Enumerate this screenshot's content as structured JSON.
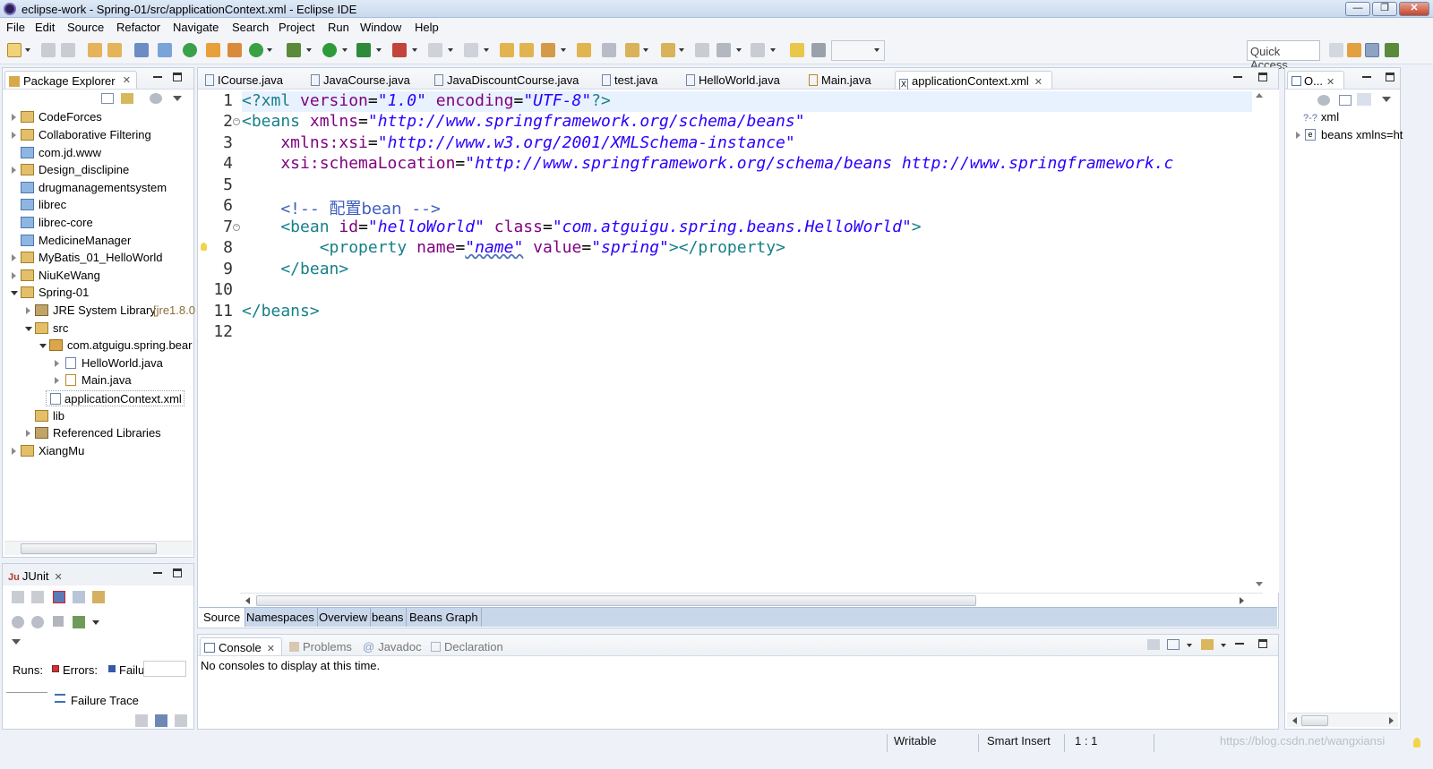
{
  "window": {
    "title": "eclipse-work - Spring-01/src/applicationContext.xml - Eclipse IDE",
    "controls": {
      "minimize": "—",
      "restore": "❐",
      "close": "✕"
    }
  },
  "menu": [
    "File",
    "Edit",
    "Source",
    "Refactor",
    "Navigate",
    "Search",
    "Project",
    "Run",
    "Window",
    "Help"
  ],
  "toolbar": {
    "quick_access": "Quick Access"
  },
  "package_explorer": {
    "title": "Package Explorer",
    "items": [
      {
        "label": "CodeForces",
        "suffix": ""
      },
      {
        "label": "Collaborative Filtering",
        "suffix": ""
      },
      {
        "label": "com.jd.www",
        "suffix": ""
      },
      {
        "label": "Design_disclipine",
        "suffix": ""
      },
      {
        "label": "drugmanagementsystem",
        "suffix": ""
      },
      {
        "label": "librec",
        "suffix": ""
      },
      {
        "label": "librec-core",
        "suffix": ""
      },
      {
        "label": "MedicineManager",
        "suffix": ""
      },
      {
        "label": "MyBatis_01_HelloWorld",
        "suffix": ""
      },
      {
        "label": "NiuKeWang",
        "suffix": ""
      },
      {
        "label": "Spring-01",
        "suffix": ""
      },
      {
        "label": "JRE System Library",
        "suffix": "[jre1.8.0"
      },
      {
        "label": "src",
        "suffix": ""
      },
      {
        "label": "com.atguigu.spring.bear",
        "suffix": ""
      },
      {
        "label": "HelloWorld.java",
        "suffix": ""
      },
      {
        "label": "Main.java",
        "suffix": ""
      },
      {
        "label": "applicationContext.xml",
        "suffix": ""
      },
      {
        "label": "lib",
        "suffix": ""
      },
      {
        "label": "Referenced Libraries",
        "suffix": ""
      },
      {
        "label": "XiangMu",
        "suffix": ""
      }
    ]
  },
  "junit": {
    "title": "JUnit",
    "runs_label": "Runs:",
    "errors_label": "Errors:",
    "failures_label": "Failu",
    "failure_trace": "Failure Trace"
  },
  "editor": {
    "tabs": [
      "ICourse.java",
      "JavaCourse.java",
      "JavaDiscountCourse.java",
      "test.java",
      "HelloWorld.java",
      "Main.java",
      "applicationContext.xml"
    ],
    "active_tab": "applicationContext.xml",
    "line_numbers": [
      "1",
      "2",
      "3",
      "4",
      "5",
      "6",
      "7",
      "8",
      "9",
      "10",
      "11",
      "12"
    ],
    "code": {
      "l1": {
        "a": "<?xml ",
        "b": "version",
        "c": "=",
        "d": "\"1.0\"",
        "e": " encoding",
        "f": "=",
        "g": "\"UTF-8\"",
        "h": "?>"
      },
      "l2": {
        "a": "<beans ",
        "b": "xmlns",
        "c": "=",
        "d": "\"http://www.springframework.org/schema/beans\""
      },
      "l3": {
        "a": "    xmlns:xsi",
        "b": "=",
        "c": "\"http://www.w3.org/2001/XMLSchema-instance\""
      },
      "l4": {
        "a": "    xsi:schemaLocation",
        "b": "=",
        "c": "\"http://www.springframework.org/schema/beans http://www.springframework.c"
      },
      "l6": {
        "a": "    <!-- ",
        "b": "配置bean",
        "c": " -->"
      },
      "l7": {
        "a": "    <bean ",
        "b": "id",
        "c": "=",
        "d": "\"helloWorld\"",
        "e": " class",
        "f": "=",
        "g": "\"com.atguigu.spring.beans.HelloWorld\"",
        "h": ">"
      },
      "l8": {
        "a": "        <property ",
        "b": "name",
        "c": "=",
        "d": "\"name\"",
        "e": " value",
        "f": "=",
        "g": "\"spring\"",
        "h": "></property>"
      },
      "l9": {
        "a": "    </bean>"
      },
      "l11": {
        "a": "</beans>"
      }
    },
    "bottom_tabs": [
      "Source",
      "Namespaces",
      "Overview",
      "beans",
      "Beans Graph"
    ]
  },
  "console": {
    "tabs": [
      "Console",
      "Problems",
      "Javadoc",
      "Declaration"
    ],
    "message": "No consoles to display at this time."
  },
  "outline": {
    "title": "O...",
    "items": [
      "xml",
      "beans xmlns=ht"
    ],
    "xml_prefix": "?-?"
  },
  "statusbar": {
    "writable": "Writable",
    "insert_mode": "Smart Insert",
    "position": "1 : 1",
    "watermark": "https://blog.csdn.net/wangxiansi"
  }
}
